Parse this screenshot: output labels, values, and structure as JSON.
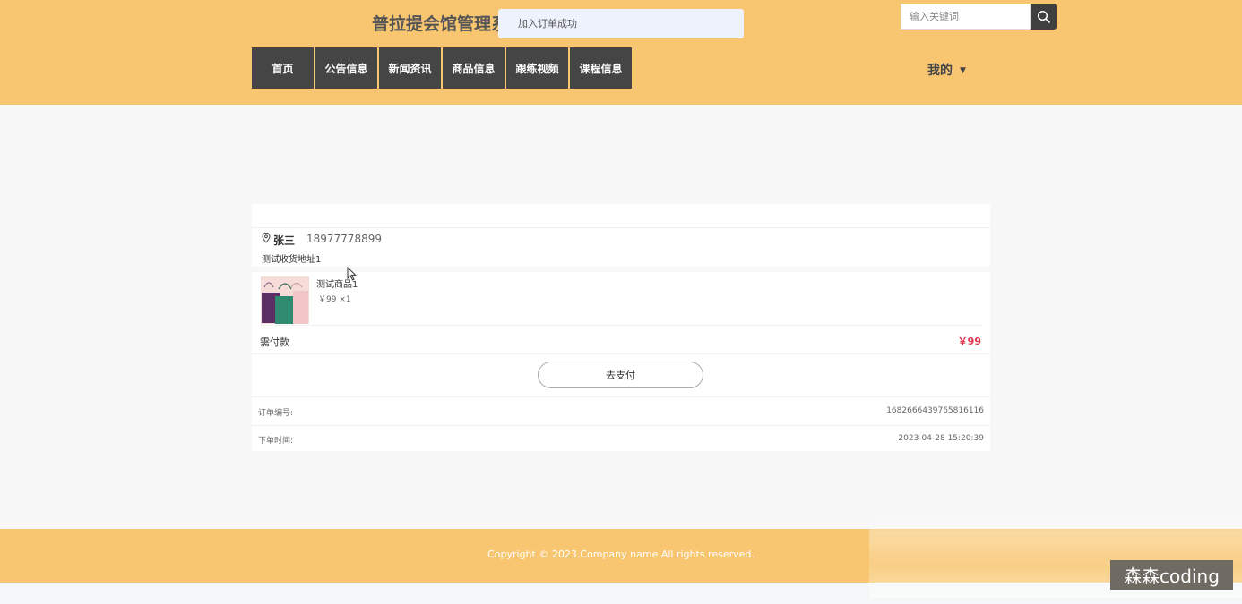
{
  "header": {
    "site_title": "普拉提会馆管理系",
    "toast": "加入订单成功",
    "search_placeholder": "输入关键词",
    "nav": [
      "首页",
      "公告信息",
      "新闻资讯",
      "商品信息",
      "跟练视频",
      "课程信息"
    ],
    "my_menu": "我的",
    "accent_color": "#f8c670",
    "nav_color": "#454545"
  },
  "address": {
    "name": "张三",
    "phone": "18977778899",
    "detail": "测试收货地址1"
  },
  "product": {
    "name": "测试商品1",
    "price_qty": "￥99 ×1"
  },
  "payment": {
    "label": "需付款",
    "amount": "￥99",
    "button": "去支付",
    "amount_color": "#e0334a"
  },
  "order_info": {
    "number_label": "订单编号:",
    "number_value": "1682666439765816116",
    "time_label": "下单时间:",
    "time_value": "2023-04-28 15:20:39"
  },
  "footer": {
    "copyright": "Copyright © 2023.Company name All rights reserved."
  },
  "watermark": "森森coding"
}
